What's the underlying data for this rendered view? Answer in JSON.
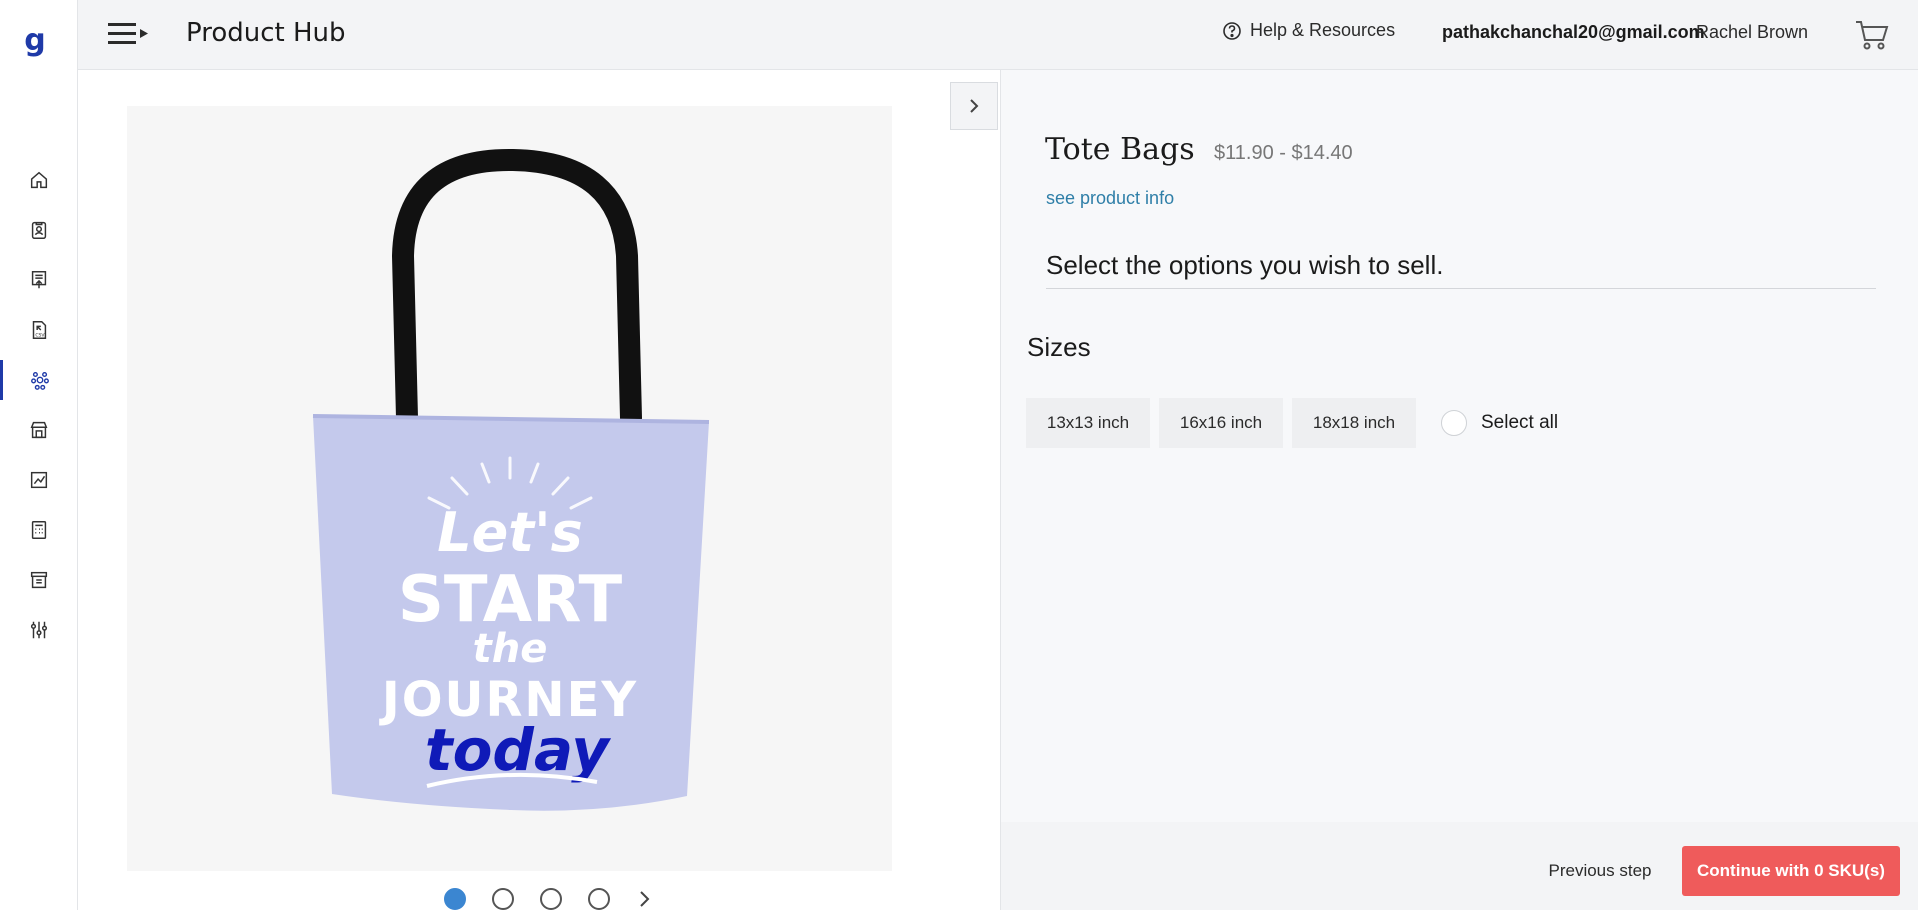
{
  "app": {
    "logo_icon": "g-logo-icon"
  },
  "sidebar": {
    "items": [
      {
        "icon": "home-icon"
      },
      {
        "icon": "clipboard-user-icon"
      },
      {
        "icon": "document-upload-icon"
      },
      {
        "icon": "csv-import-icon"
      },
      {
        "icon": "network-nodes-icon",
        "active": true
      },
      {
        "icon": "storefront-icon"
      },
      {
        "icon": "analytics-chart-icon"
      },
      {
        "icon": "calculator-icon"
      },
      {
        "icon": "archive-box-icon"
      },
      {
        "icon": "sliders-settings-icon"
      }
    ]
  },
  "header": {
    "title": "Product Hub",
    "help_label": "Help & Resources",
    "email": "pathakchanchal20@gmail.com",
    "username": "Rachel Brown"
  },
  "product": {
    "name": "Tote Bags",
    "price_range": "$11.90 - $14.40",
    "info_link": "see product info",
    "image_text": {
      "line1": "Let's",
      "line2": "START",
      "line3": "the",
      "line4": "JOURNEY",
      "line5": "today"
    },
    "carousel_count": 4,
    "carousel_active_index": 0
  },
  "options": {
    "instruction": "Select the options you wish to sell.",
    "sizes_label": "Sizes",
    "sizes": [
      "13x13 inch",
      "16x16 inch",
      "18x18 inch"
    ],
    "select_all_label": "Select all"
  },
  "footer": {
    "previous_label": "Previous step",
    "continue_label": "Continue with 0 SKU(s)"
  },
  "colors": {
    "accent": "#1f3aa8",
    "continue_button": "#ef5b5b",
    "link": "#2f7fa8",
    "bag_body": "#c4c9ec",
    "bag_handle": "#111111",
    "carousel_active": "#3b86d1"
  }
}
